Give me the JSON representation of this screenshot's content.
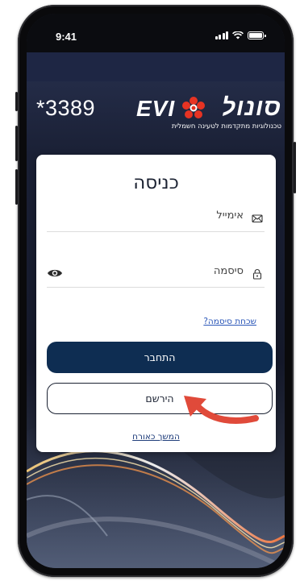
{
  "status_bar": {
    "time": "9:41",
    "battery_level": 1.0
  },
  "header": {
    "promo_code": "*3389",
    "logo": {
      "brand_hebrew": "סונול",
      "brand_latin": "EVI",
      "tagline": "טכנולוגיות מתקדמות לטעינה חשמלית",
      "mark_color": "#e63323"
    }
  },
  "login_card": {
    "title": "כניסה",
    "email": {
      "placeholder": "אימייל",
      "value": "",
      "icon": "mail-icon"
    },
    "password": {
      "placeholder": "סיסמה",
      "value": "",
      "icon": "lock-icon",
      "toggle_icon": "eye-icon"
    },
    "forgot_password": "שכחת סיסמה?",
    "login_button": "התחבר",
    "register_button": "הירשם",
    "guest_link": "המשך כאורח"
  },
  "annotation": {
    "icon": "red-arrow-icon",
    "color": "#e04a3a"
  },
  "colors": {
    "primary": "#0e2d52",
    "background": "#1b2236",
    "link": "#2a56b8",
    "brand_red": "#e63323"
  }
}
